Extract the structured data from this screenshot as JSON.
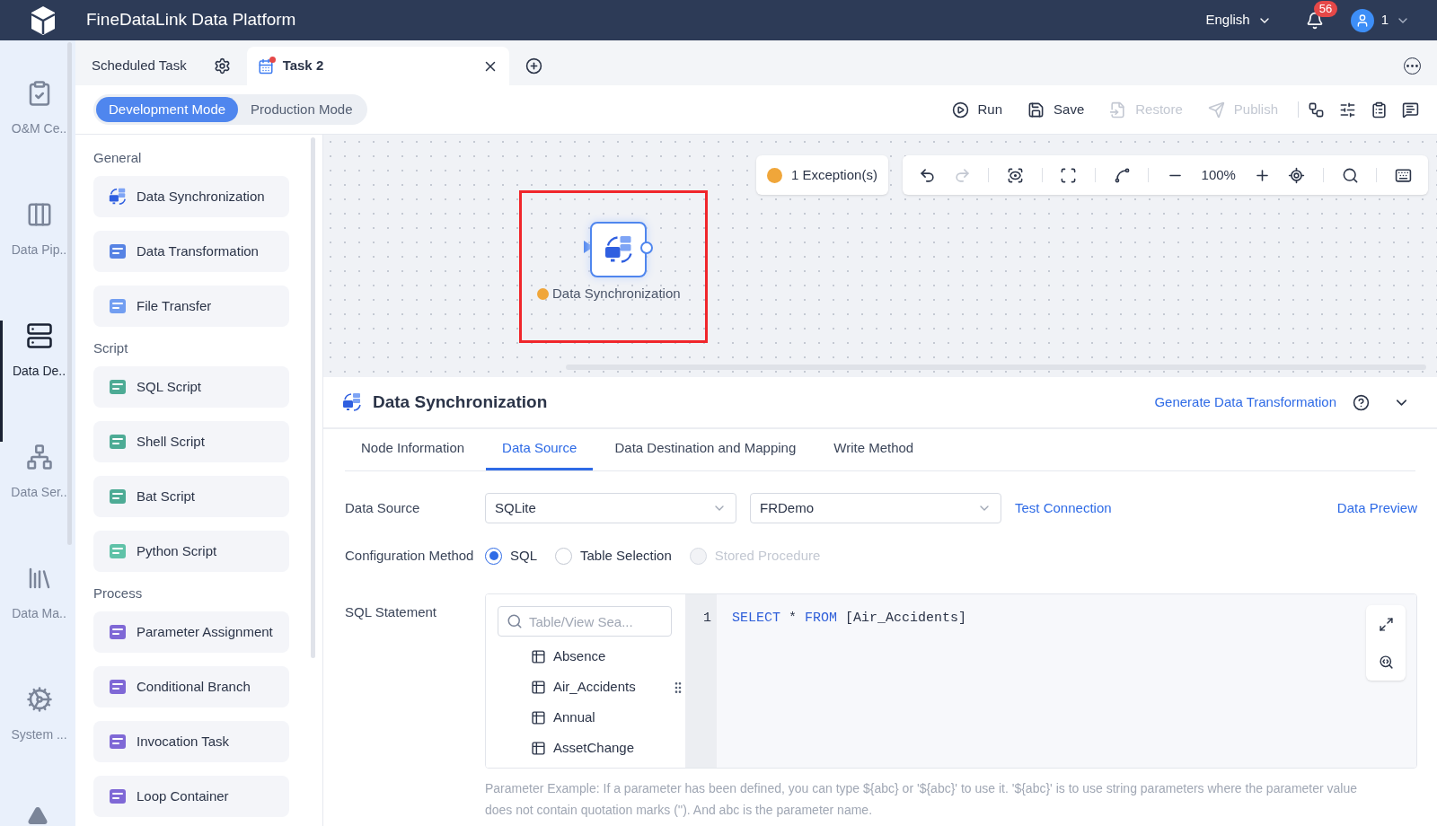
{
  "header": {
    "title": "FineDataLink Data Platform",
    "language": "English",
    "notifications": "56",
    "user": "1"
  },
  "nav": [
    {
      "label": "O&M Ce..",
      "selected": false
    },
    {
      "label": "Data Pip..",
      "selected": false
    },
    {
      "label": "Data De..",
      "selected": true
    },
    {
      "label": "Data Ser..",
      "selected": false
    },
    {
      "label": "Data Ma..",
      "selected": false
    },
    {
      "label": "System ...",
      "selected": false
    }
  ],
  "tabs": [
    {
      "label": "Scheduled Task",
      "kind": "fixed",
      "selected": false
    },
    {
      "label": "Task 2",
      "kind": "task",
      "selected": true,
      "unsaved": true
    }
  ],
  "modes": [
    {
      "label": "Development Mode",
      "selected": true
    },
    {
      "label": "Production Mode",
      "selected": false
    }
  ],
  "actions": [
    {
      "label": "Run",
      "disabled": false
    },
    {
      "label": "Save",
      "disabled": false
    },
    {
      "label": "Restore",
      "disabled": true
    },
    {
      "label": "Publish",
      "disabled": true
    }
  ],
  "palette": [
    {
      "title": "General",
      "items": [
        "Data Synchronization",
        "Data Transformation",
        "File Transfer"
      ]
    },
    {
      "title": "Script",
      "items": [
        "SQL Script",
        "Shell Script",
        "Bat Script",
        "Python Script"
      ]
    },
    {
      "title": "Process",
      "items": [
        "Parameter Assignment",
        "Conditional Branch",
        "Invocation Task",
        "Loop Container"
      ]
    }
  ],
  "canvas": {
    "exceptions": "1 Exception(s)",
    "zoom": "100%",
    "node": {
      "label": "Data Synchronization",
      "warning": true,
      "highlighted": true
    }
  },
  "panel": {
    "title": "Data Synchronization",
    "link": "Generate Data Transformation",
    "tabs": [
      {
        "label": "Node Information",
        "selected": false
      },
      {
        "label": "Data Source",
        "selected": true
      },
      {
        "label": "Data Destination and Mapping",
        "selected": false
      },
      {
        "label": "Write Method",
        "selected": false
      }
    ],
    "data_source": {
      "label": "Data Source",
      "type": "SQLite",
      "connection": "FRDemo",
      "test": "Test Connection",
      "preview": "Data Preview"
    },
    "config": {
      "label": "Configuration Method",
      "options": [
        {
          "label": "SQL",
          "selected": true,
          "disabled": false
        },
        {
          "label": "Table Selection",
          "selected": false,
          "disabled": false
        },
        {
          "label": "Stored Procedure",
          "selected": false,
          "disabled": true
        }
      ]
    },
    "sql": {
      "label": "SQL Statement",
      "search_placeholder": "Table/View Sea...",
      "tables": [
        "Absence",
        "Air_Accidents",
        "Annual",
        "AssetChange"
      ],
      "line": "1",
      "code": [
        {
          "text": "SELECT",
          "kind": "keyword"
        },
        {
          "text": " * ",
          "kind": "plain"
        },
        {
          "text": "FROM",
          "kind": "keyword"
        },
        {
          "text": " [Air_Accidents]",
          "kind": "plain"
        }
      ]
    },
    "help": "Parameter Example: If a parameter has been defined, you can type ${abc} or '${abc}' to use it. '${abc}' is to use string parameters where the parameter value does not contain quotation marks (''). And abc is the parameter name."
  }
}
